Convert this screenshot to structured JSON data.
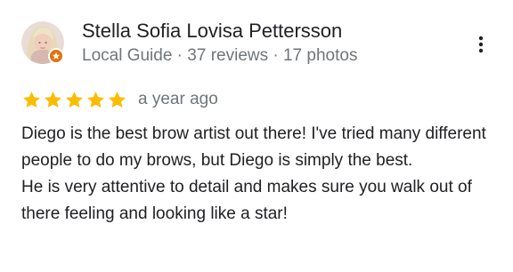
{
  "review": {
    "author": {
      "name": "Stella Sofia Lovisa Pettersson",
      "meta": "Local Guide · 37 reviews · 17 photos",
      "avatar_icon": "profile-photo",
      "badge_icon": "local-guide-star-icon"
    },
    "more_icon": "more-vert-icon",
    "rating": {
      "stars": 5,
      "out_of": 5,
      "date": "a year ago"
    },
    "text": [
      "Diego is the best brow artist out there! I've tried many different people to do my brows, but Diego is simply the best.",
      "He is very attentive to detail and makes sure you walk out of there feeling and looking like a star!"
    ]
  },
  "colors": {
    "star": "#fbbc04",
    "badge": "#e8710a",
    "secondary_text": "#70757a",
    "primary_text": "#202124"
  }
}
